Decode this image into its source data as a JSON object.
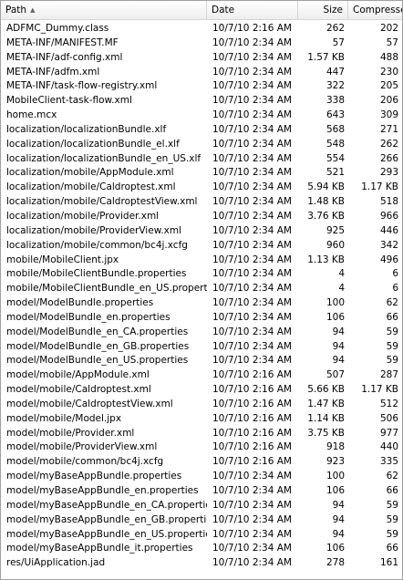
{
  "columns": {
    "path": "Path",
    "date": "Date",
    "size": "Size",
    "compressed": "Compressed",
    "sort_icon": "triangle-up-icon"
  },
  "rows": [
    {
      "path": "ADFMC_Dummy.class",
      "date": "10/7/10 2:16 AM",
      "size": "262",
      "compressed": "202"
    },
    {
      "path": "META-INF/MANIFEST.MF",
      "date": "10/7/10 2:34 AM",
      "size": "57",
      "compressed": "57"
    },
    {
      "path": "META-INF/adf-config.xml",
      "date": "10/7/10 2:34 AM",
      "size": "1.57 KB",
      "compressed": "488"
    },
    {
      "path": "META-INF/adfm.xml",
      "date": "10/7/10 2:34 AM",
      "size": "447",
      "compressed": "230"
    },
    {
      "path": "META-INF/task-flow-registry.xml",
      "date": "10/7/10 2:34 AM",
      "size": "322",
      "compressed": "205"
    },
    {
      "path": "MobileClient-task-flow.xml",
      "date": "10/7/10 2:34 AM",
      "size": "338",
      "compressed": "206"
    },
    {
      "path": "home.mcx",
      "date": "10/7/10 2:34 AM",
      "size": "643",
      "compressed": "309"
    },
    {
      "path": "localization/localizationBundle.xlf",
      "date": "10/7/10 2:34 AM",
      "size": "568",
      "compressed": "271"
    },
    {
      "path": "localization/localizationBundle_el.xlf",
      "date": "10/7/10 2:34 AM",
      "size": "548",
      "compressed": "262"
    },
    {
      "path": "localization/localizationBundle_en_US.xlf",
      "date": "10/7/10 2:34 AM",
      "size": "554",
      "compressed": "266"
    },
    {
      "path": "localization/mobile/AppModule.xml",
      "date": "10/7/10 2:34 AM",
      "size": "521",
      "compressed": "293"
    },
    {
      "path": "localization/mobile/Caldroptest.xml",
      "date": "10/7/10 2:34 AM",
      "size": "5.94 KB",
      "compressed": "1.17 KB"
    },
    {
      "path": "localization/mobile/CaldroptestView.xml",
      "date": "10/7/10 2:34 AM",
      "size": "1.48 KB",
      "compressed": "518"
    },
    {
      "path": "localization/mobile/Provider.xml",
      "date": "10/7/10 2:34 AM",
      "size": "3.76 KB",
      "compressed": "966"
    },
    {
      "path": "localization/mobile/ProviderView.xml",
      "date": "10/7/10 2:34 AM",
      "size": "925",
      "compressed": "446"
    },
    {
      "path": "localization/mobile/common/bc4j.xcfg",
      "date": "10/7/10 2:34 AM",
      "size": "960",
      "compressed": "342"
    },
    {
      "path": "mobile/MobileClient.jpx",
      "date": "10/7/10 2:34 AM",
      "size": "1.13 KB",
      "compressed": "496"
    },
    {
      "path": "mobile/MobileClientBundle.properties",
      "date": "10/7/10 2:34 AM",
      "size": "4",
      "compressed": "6"
    },
    {
      "path": "mobile/MobileClientBundle_en_US.properties",
      "date": "10/7/10 2:34 AM",
      "size": "4",
      "compressed": "6"
    },
    {
      "path": "model/ModelBundle.properties",
      "date": "10/7/10 2:34 AM",
      "size": "100",
      "compressed": "62"
    },
    {
      "path": "model/ModelBundle_en.properties",
      "date": "10/7/10 2:34 AM",
      "size": "106",
      "compressed": "66"
    },
    {
      "path": "model/ModelBundle_en_CA.properties",
      "date": "10/7/10 2:34 AM",
      "size": "94",
      "compressed": "59"
    },
    {
      "path": "model/ModelBundle_en_GB.properties",
      "date": "10/7/10 2:34 AM",
      "size": "94",
      "compressed": "59"
    },
    {
      "path": "model/ModelBundle_en_US.properties",
      "date": "10/7/10 2:34 AM",
      "size": "94",
      "compressed": "59"
    },
    {
      "path": "model/mobile/AppModule.xml",
      "date": "10/7/10 2:16 AM",
      "size": "507",
      "compressed": "287"
    },
    {
      "path": "model/mobile/Caldroptest.xml",
      "date": "10/7/10 2:16 AM",
      "size": "5.66 KB",
      "compressed": "1.17 KB"
    },
    {
      "path": "model/mobile/CaldroptestView.xml",
      "date": "10/7/10 2:16 AM",
      "size": "1.47 KB",
      "compressed": "512"
    },
    {
      "path": "model/mobile/Model.jpx",
      "date": "10/7/10 2:16 AM",
      "size": "1.14 KB",
      "compressed": "506"
    },
    {
      "path": "model/mobile/Provider.xml",
      "date": "10/7/10 2:16 AM",
      "size": "3.75 KB",
      "compressed": "977"
    },
    {
      "path": "model/mobile/ProviderView.xml",
      "date": "10/7/10 2:16 AM",
      "size": "918",
      "compressed": "440"
    },
    {
      "path": "model/mobile/common/bc4j.xcfg",
      "date": "10/7/10 2:16 AM",
      "size": "923",
      "compressed": "335"
    },
    {
      "path": "model/myBaseAppBundle.properties",
      "date": "10/7/10 2:34 AM",
      "size": "100",
      "compressed": "62"
    },
    {
      "path": "model/myBaseAppBundle_en.properties",
      "date": "10/7/10 2:34 AM",
      "size": "106",
      "compressed": "66"
    },
    {
      "path": "model/myBaseAppBundle_en_CA.properties",
      "date": "10/7/10 2:34 AM",
      "size": "94",
      "compressed": "59"
    },
    {
      "path": "model/myBaseAppBundle_en_GB.properties",
      "date": "10/7/10 2:34 AM",
      "size": "94",
      "compressed": "59"
    },
    {
      "path": "model/myBaseAppBundle_en_US.properties",
      "date": "10/7/10 2:34 AM",
      "size": "94",
      "compressed": "59"
    },
    {
      "path": "model/myBaseAppBundle_it.properties",
      "date": "10/7/10 2:34 AM",
      "size": "106",
      "compressed": "66"
    },
    {
      "path": "res/UiApplication.jad",
      "date": "10/7/10 2:34 AM",
      "size": "278",
      "compressed": "161"
    }
  ]
}
